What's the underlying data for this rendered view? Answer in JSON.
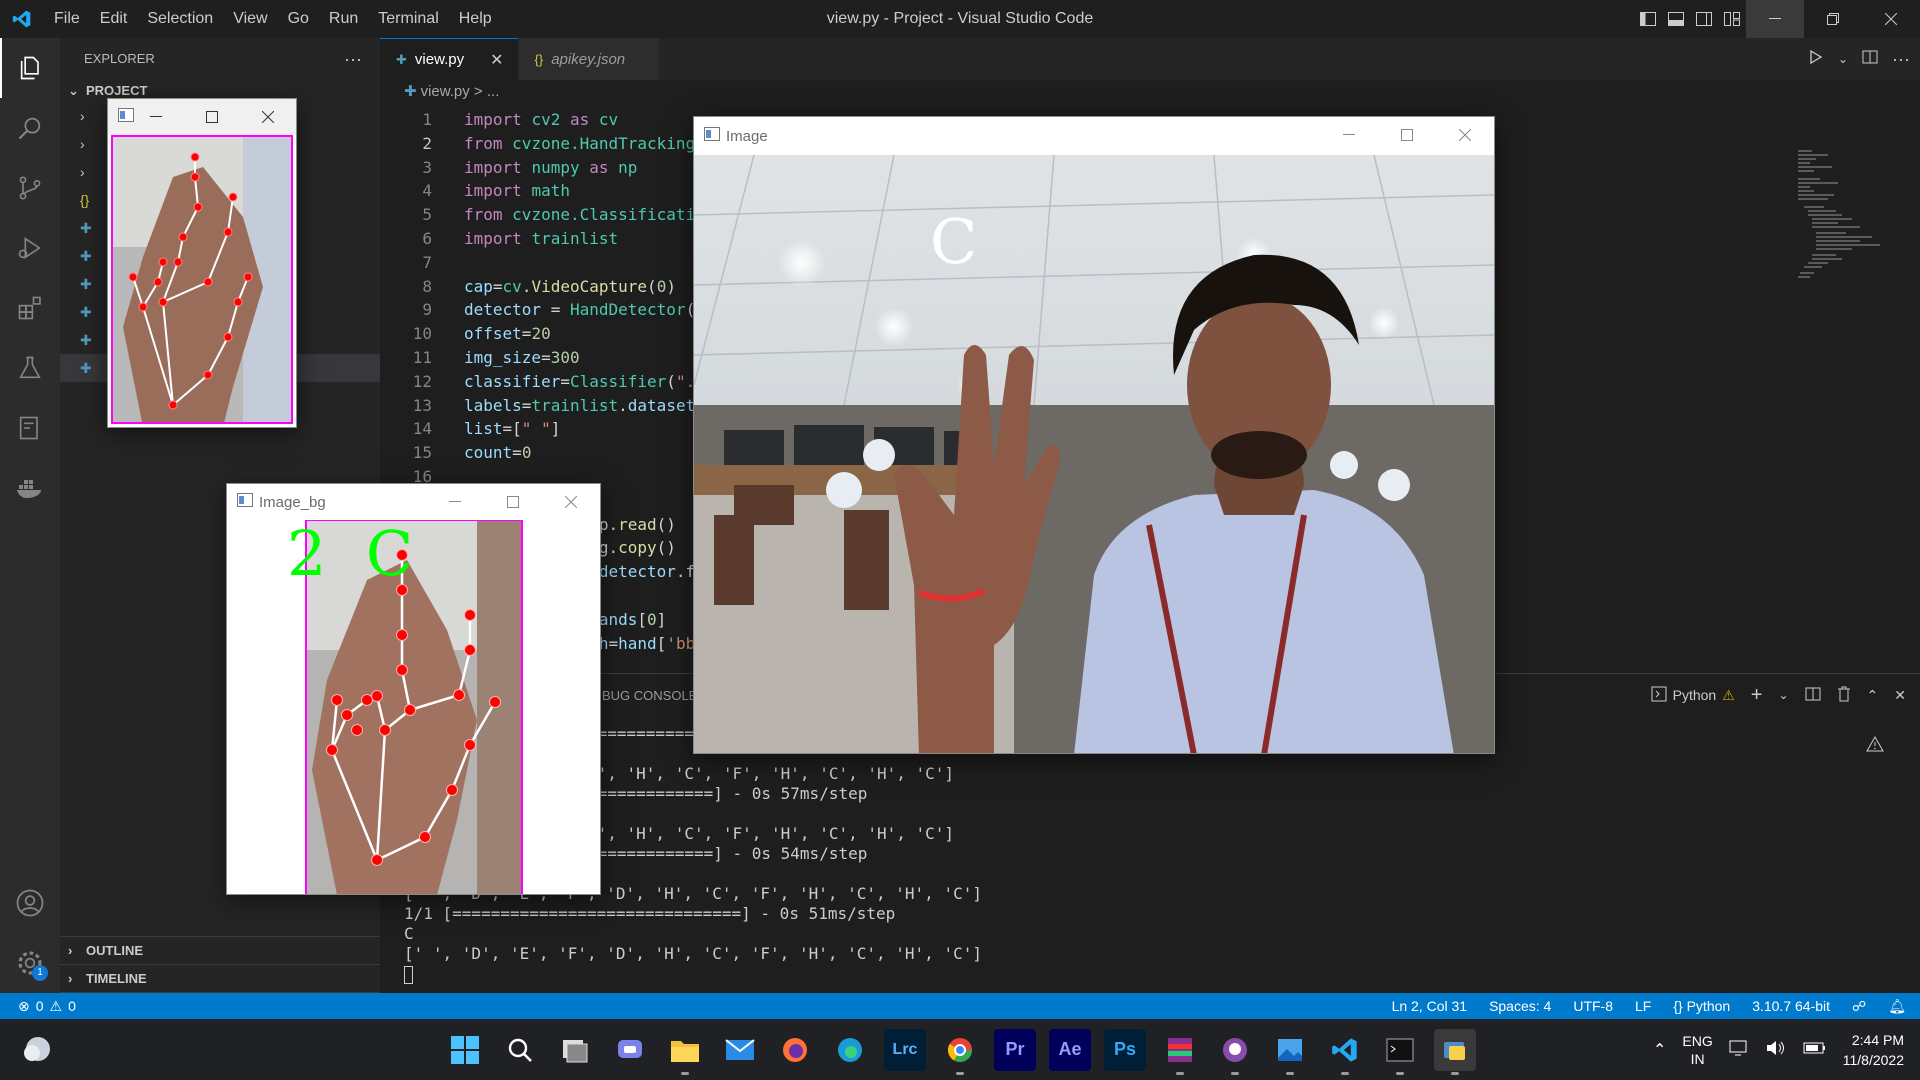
{
  "window": {
    "title": "view.py - Project - Visual Studio Code",
    "menu": [
      "File",
      "Edit",
      "Selection",
      "View",
      "Go",
      "Run",
      "Terminal",
      "Help"
    ]
  },
  "sidebar": {
    "header": "EXPLORER",
    "more": "···",
    "project": "PROJECT",
    "outline": "OUTLINE",
    "timeline": "TIMELINE"
  },
  "editor": {
    "tabs": [
      {
        "label": "view.py",
        "icon": "python-file-icon",
        "active": true
      },
      {
        "label": "apikey.json",
        "icon": "json-file-icon",
        "active": false
      }
    ],
    "breadcrumb": "view.py > ...",
    "line_numbers": [
      "1",
      "2",
      "3",
      "4",
      "5",
      "6",
      "7",
      "8",
      "9",
      "10",
      "11",
      "12",
      "13",
      "14",
      "15",
      "16"
    ],
    "current_line": 2
  },
  "panel": {
    "tab_debug": "BUG CONSOLE",
    "terminal_name": "Python",
    "terminal_lines": [
      "==========================",
      "",
      "D', 'H', 'C', 'F', 'H', 'C', 'H', 'C']",
      "=============] - 0s 57ms/step",
      "",
      "D', 'H', 'C', 'F', 'H', 'C', 'H', 'C']",
      "=============] - 0s 54ms/step",
      "",
      "[' ', 'D', 'E', 'F', 'D', 'H', 'C', 'F', 'H', 'C', 'H', 'C']",
      "1/1 [==============================] - 0s 51ms/step",
      "C",
      "[' ', 'D', 'E', 'F', 'D', 'H', 'C', 'F', 'H', 'C', 'H', 'C']"
    ]
  },
  "statusbar": {
    "errors": "0",
    "warnings": "0",
    "position": "Ln 2, Col 31",
    "spaces": "Spaces: 4",
    "encoding": "UTF-8",
    "eol": "LF",
    "language": "Python",
    "interpreter": "3.10.7 64-bit"
  },
  "taskbar": {
    "apps": [
      "Lrc",
      "Pr",
      "Ae",
      "Ps"
    ],
    "lang_top": "ENG",
    "lang_bottom": "IN",
    "time": "2:44 PM",
    "date": "11/8/2022"
  },
  "image_window": {
    "title": "Image",
    "overlay_letter": "C"
  },
  "image_bg_window": {
    "title": "Image_bg",
    "overlay_text": "2  C"
  },
  "crop_window": {
    "title": ""
  },
  "colors": {
    "accent": "#007acc",
    "status_bg": "#007acc",
    "landmark": "#ff0000",
    "bbox": "#ff00ff",
    "overlay_green": "#00ff00"
  }
}
